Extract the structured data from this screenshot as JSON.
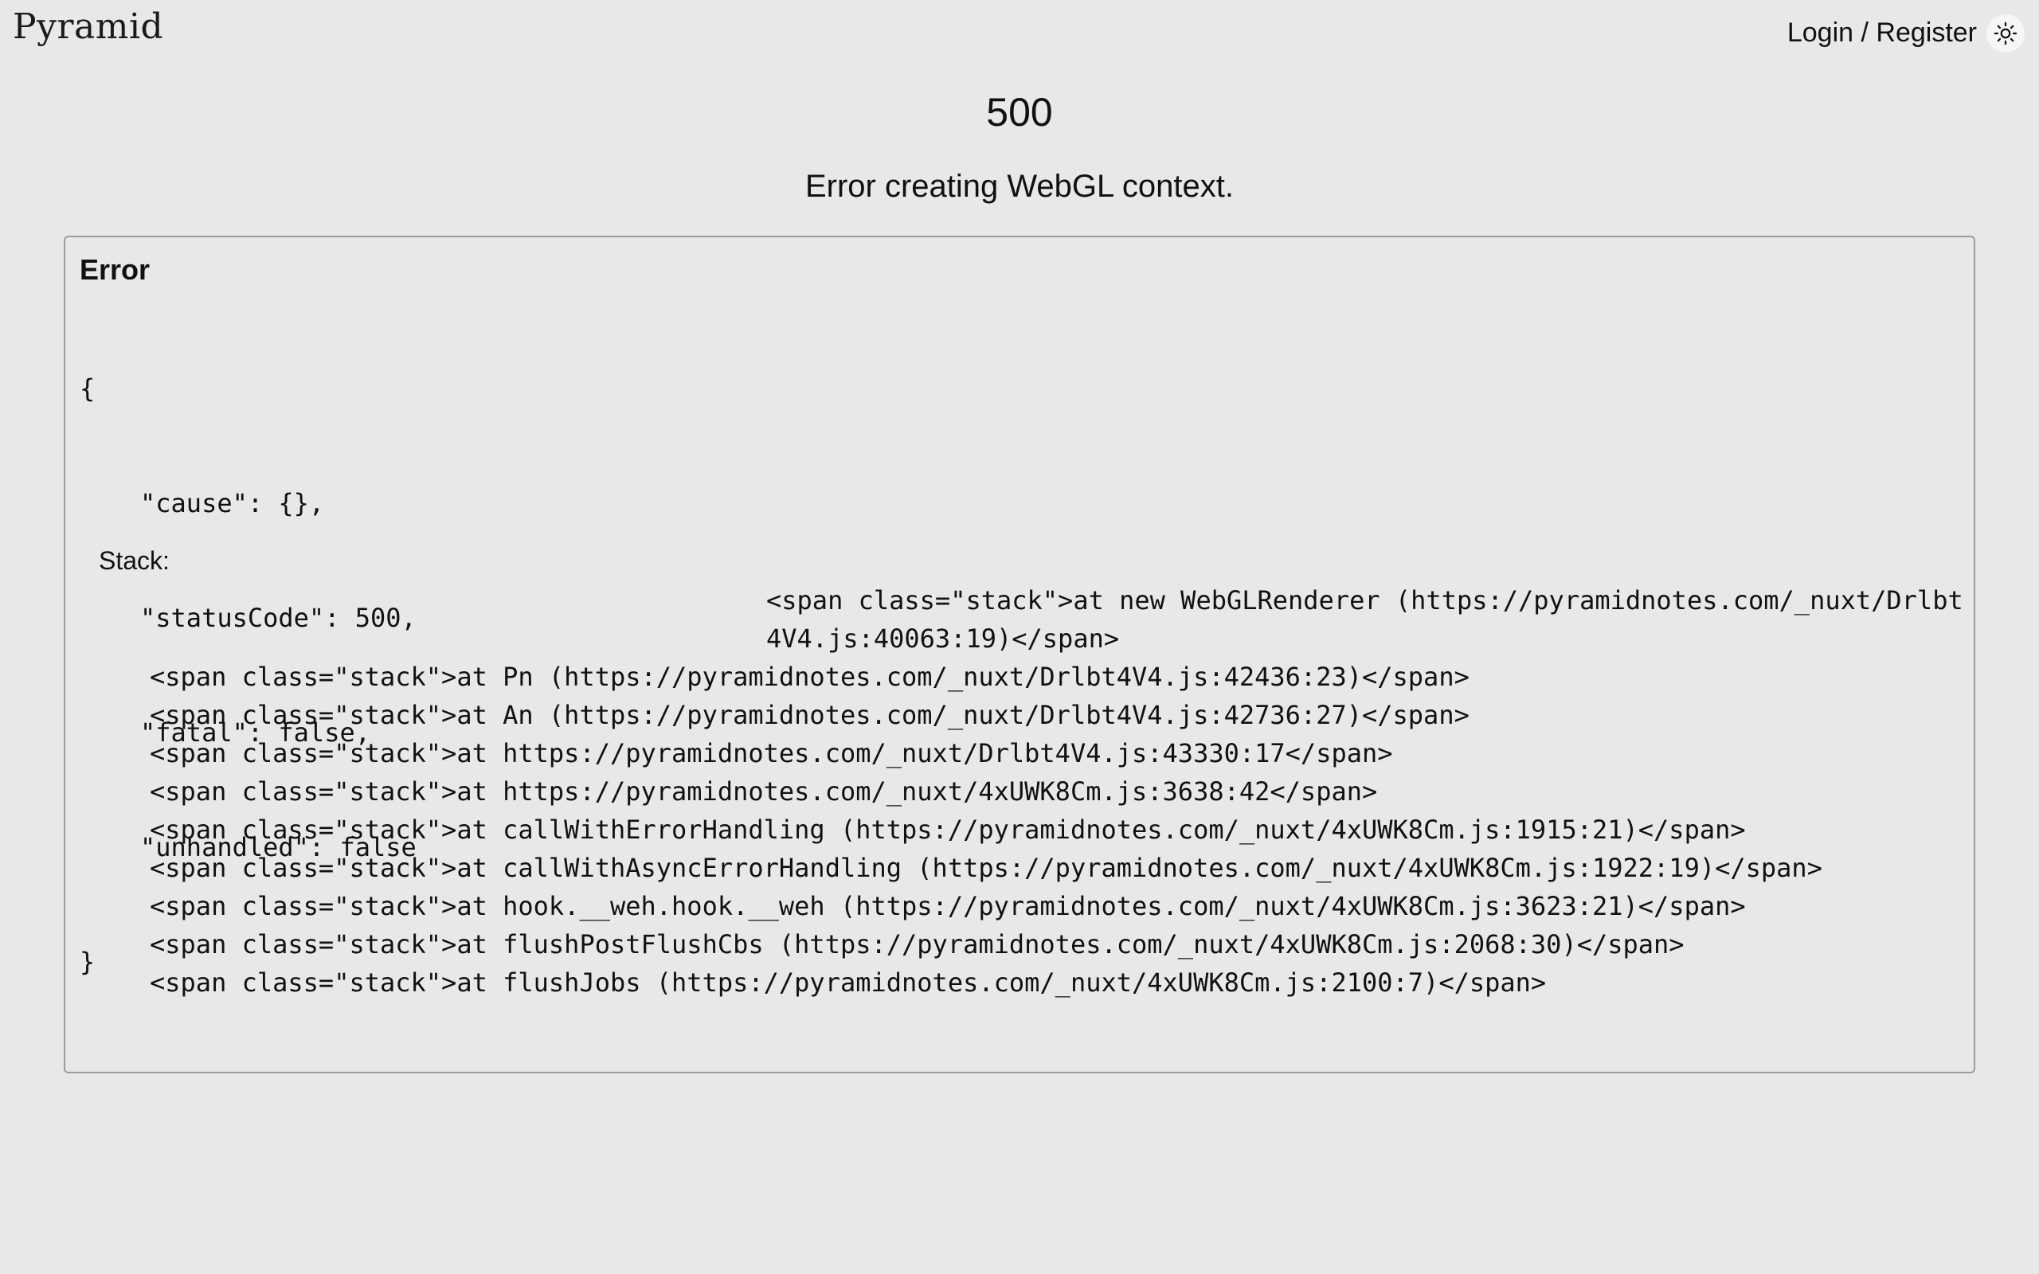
{
  "header": {
    "logo": "Pyramid",
    "login_label": "Login / Register",
    "theme_icon": "sun-icon"
  },
  "error_page": {
    "status_code": "500",
    "message": "Error creating WebGL context."
  },
  "error_box": {
    "title": "Error",
    "json_lines": [
      "{",
      "\"cause\": {},",
      "\"statusCode\": 500,",
      "\"fatal\": false,",
      "\"unhandled\": false",
      "}"
    ],
    "stack_label": "Stack:",
    "stack_lines": [
      "<span class=\"stack\">at new WebGLRenderer (https://pyramidnotes.com/_nuxt/Drlbt4V4.js:40063:19)</span>",
      "<span class=\"stack\">at Pn (https://pyramidnotes.com/_nuxt/Drlbt4V4.js:42436:23)</span>",
      "<span class=\"stack\">at An (https://pyramidnotes.com/_nuxt/Drlbt4V4.js:42736:27)</span>",
      "<span class=\"stack\">at https://pyramidnotes.com/_nuxt/Drlbt4V4.js:43330:17</span>",
      "<span class=\"stack\">at https://pyramidnotes.com/_nuxt/4xUWK8Cm.js:3638:42</span>",
      "<span class=\"stack\">at callWithErrorHandling (https://pyramidnotes.com/_nuxt/4xUWK8Cm.js:1915:21)</span>",
      "<span class=\"stack\">at callWithAsyncErrorHandling (https://pyramidnotes.com/_nuxt/4xUWK8Cm.js:1922:19)</span>",
      "<span class=\"stack\">at hook.__weh.hook.__weh (https://pyramidnotes.com/_nuxt/4xUWK8Cm.js:3623:21)</span>",
      "<span class=\"stack\">at flushPostFlushCbs (https://pyramidnotes.com/_nuxt/4xUWK8Cm.js:2068:30)</span>",
      "<span class=\"stack\">at flushJobs (https://pyramidnotes.com/_nuxt/4xUWK8Cm.js:2100:7)</span>"
    ]
  }
}
